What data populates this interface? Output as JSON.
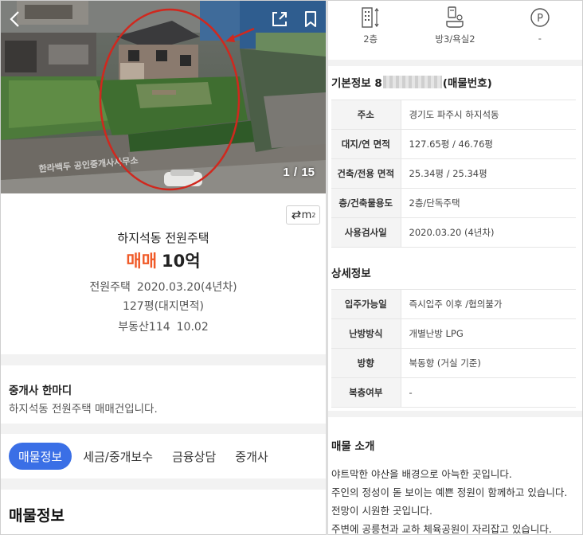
{
  "photo": {
    "counter_current": "1",
    "counter_sep": "/",
    "counter_total": "15",
    "watermark": "한라백두 공인중개사사무소"
  },
  "unit_toggle": {
    "label": "m",
    "sup": "2"
  },
  "listing": {
    "title": "하지석동 전원주택",
    "price_type": "매매",
    "price_value": "10억",
    "building_type": "전원주택",
    "approval": "2020.03.20(4년차)",
    "land_area": "127평(대지면적)",
    "source": "부동산114",
    "source_date": "10.02"
  },
  "agent_comment": {
    "title": "중개사 한마디",
    "text": "하지석동 전원주택 매매건입니다."
  },
  "tabs": [
    {
      "label": "매물정보",
      "active": true
    },
    {
      "label": "세금/중개보수",
      "active": false
    },
    {
      "label": "금융상담",
      "active": false
    },
    {
      "label": "중개사",
      "active": false
    }
  ],
  "section_heading": "매물정보",
  "summary": {
    "floor": "2층",
    "rooms": "방3/욕실2",
    "parking": "-"
  },
  "basic_info": {
    "title_prefix": "기본정보 8",
    "title_suffix": "(매물번호)",
    "rows": [
      {
        "key": "주소",
        "value": "경기도 파주시 하지석동"
      },
      {
        "key": "대지/연 면적",
        "value": "127.65평 / 46.76평"
      },
      {
        "key": "건축/전용 면적",
        "value": "25.34평 / 25.34평"
      },
      {
        "key": "층/건축물용도",
        "value": "2층/단독주택"
      },
      {
        "key": "사용검사일",
        "value": "2020.03.20 (4년차)"
      }
    ]
  },
  "detail_info": {
    "title": "상세정보",
    "rows": [
      {
        "key": "입주가능일",
        "value": "즉시입주 이후 /협의불가"
      },
      {
        "key": "난방방식",
        "value": "개별난방 LPG"
      },
      {
        "key": "방향",
        "value": "북동향 (거실 기준)"
      },
      {
        "key": "복층여부",
        "value": "-"
      }
    ]
  },
  "introduction": {
    "title": "매물 소개",
    "lines": [
      "야트막한 야산을 배경으로 아늑한 곳입니다.",
      "주인의 정성이 돋 보이는 예쁜 정원이 함께하고 있습니다.",
      "전망이 시원한 곳입니다.",
      "주변에 공릉천과 교하 체육공원이 자리잡고 있습니다."
    ]
  },
  "colors": {
    "price_accent": "#f05a28",
    "tab_active": "#3a6fe6",
    "band_gray": "#f2f2f2",
    "table_key_bg": "#f4f4f4",
    "highlight_circle": "#d0281e"
  },
  "icons": {
    "back": "chevron-left-icon",
    "share": "share-icon",
    "bookmark": "bookmark-icon",
    "floor": "building-floor-icon",
    "rooms": "room-bath-icon",
    "parking": "parking-icon"
  }
}
